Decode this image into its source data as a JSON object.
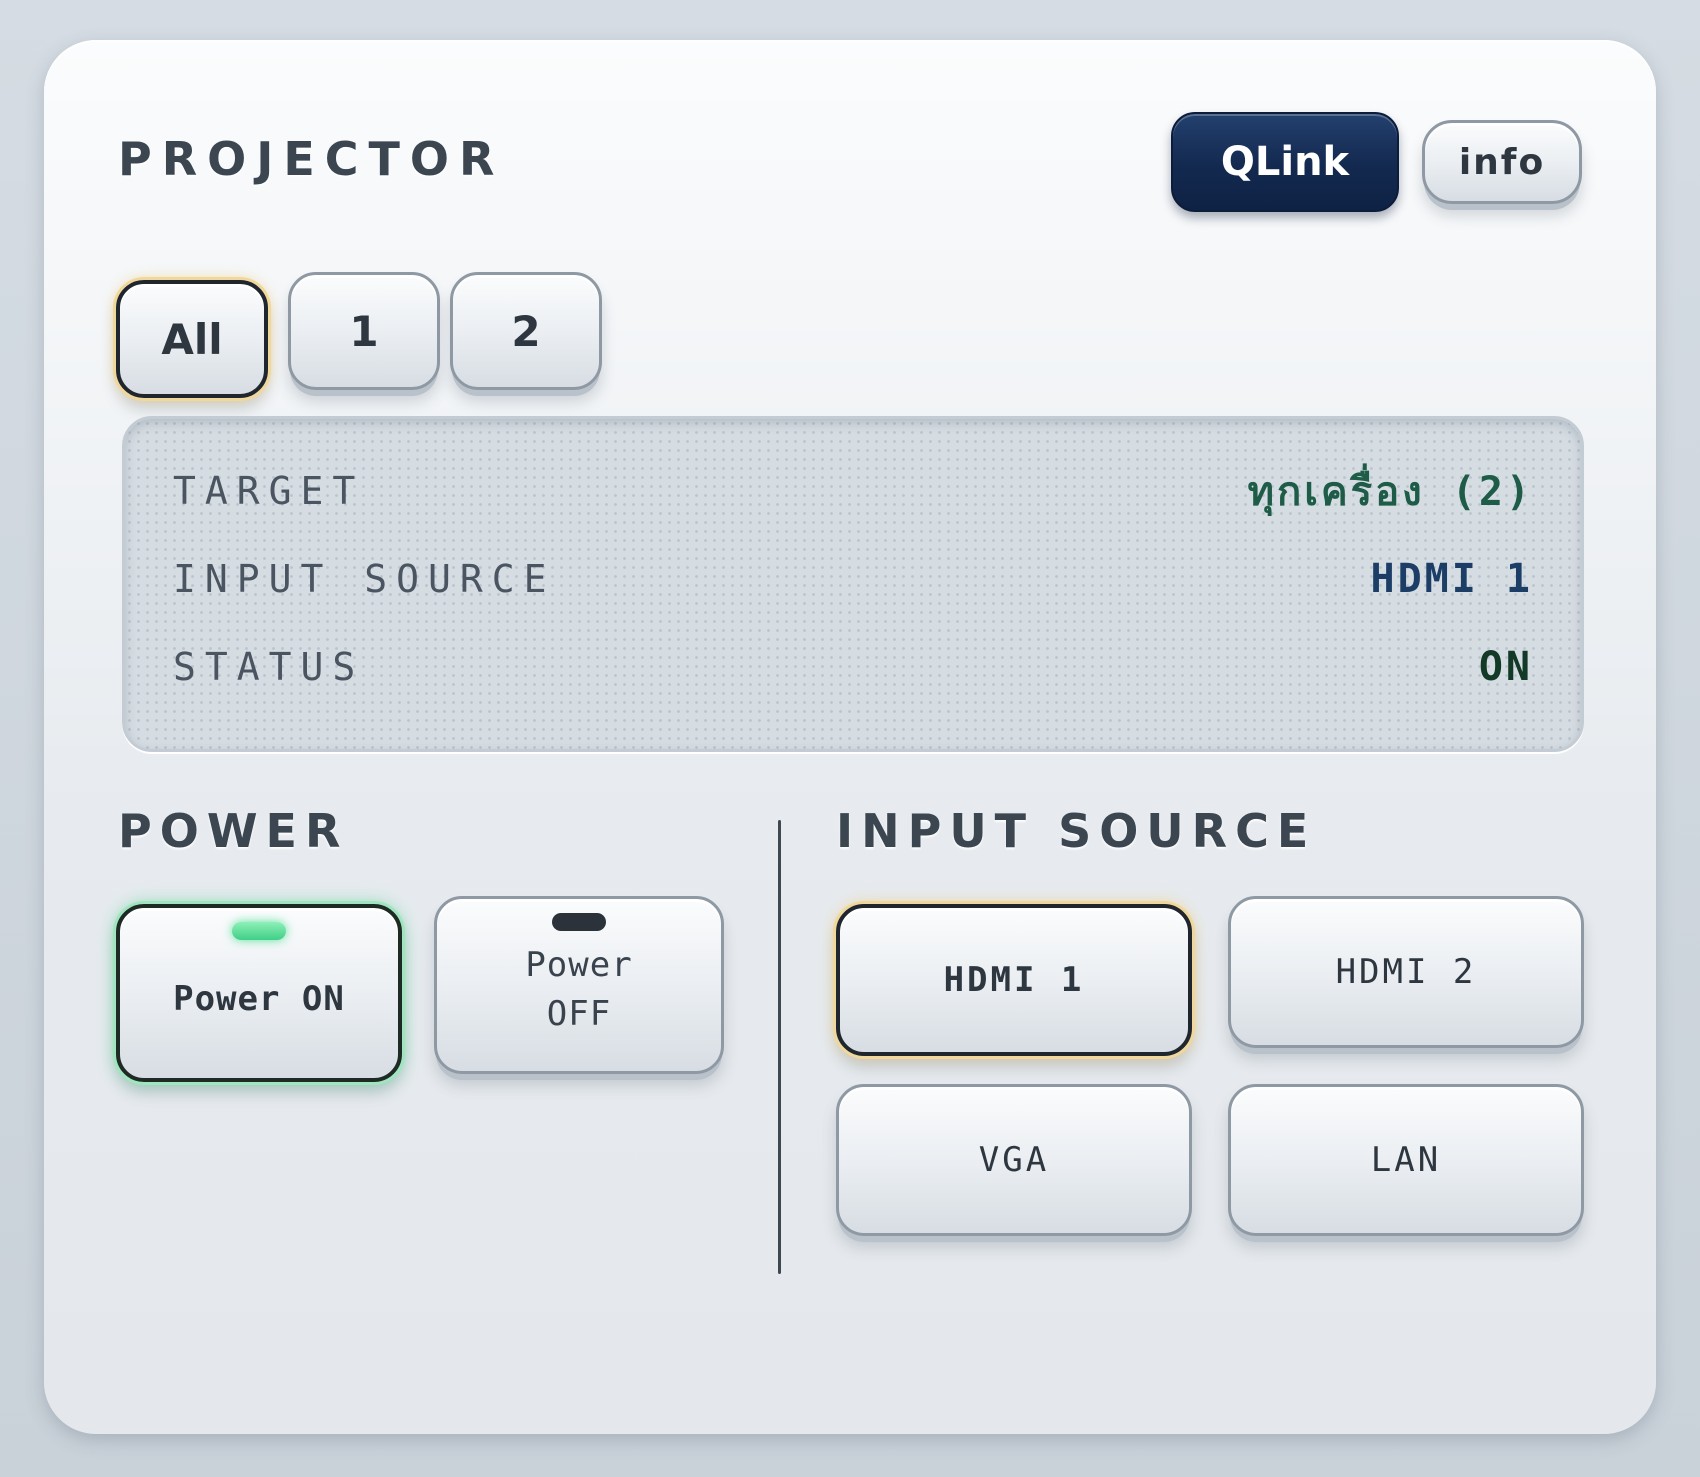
{
  "header": {
    "title": "PROJECTOR",
    "qlink_label": "QLink",
    "info_label": "info"
  },
  "tabs": [
    {
      "label": "All",
      "active": true
    },
    {
      "label": "1",
      "active": false
    },
    {
      "label": "2",
      "active": false
    }
  ],
  "display": {
    "rows": [
      {
        "label": "TARGET",
        "value": "ทุกเครื่อง (2)"
      },
      {
        "label": "INPUT SOURCE",
        "value": "HDMI 1"
      },
      {
        "label": "STATUS",
        "value": "ON"
      }
    ]
  },
  "power": {
    "title": "POWER",
    "on_label": "Power ON",
    "off_label_line1": "Power",
    "off_label_line2": "OFF",
    "state": "on"
  },
  "input_source": {
    "title": "INPUT SOURCE",
    "options": [
      {
        "label": "HDMI 1",
        "active": true
      },
      {
        "label": "HDMI 2",
        "active": false
      },
      {
        "label": "VGA",
        "active": false
      },
      {
        "label": "LAN",
        "active": false
      }
    ]
  },
  "colors": {
    "qlink_bg": "#13294f",
    "target_value": "#1e5c48",
    "source_value": "#1c3e66",
    "status_value": "#123a26",
    "active_glow": "#f2d79a",
    "power_on_led": "#3fcf86"
  }
}
